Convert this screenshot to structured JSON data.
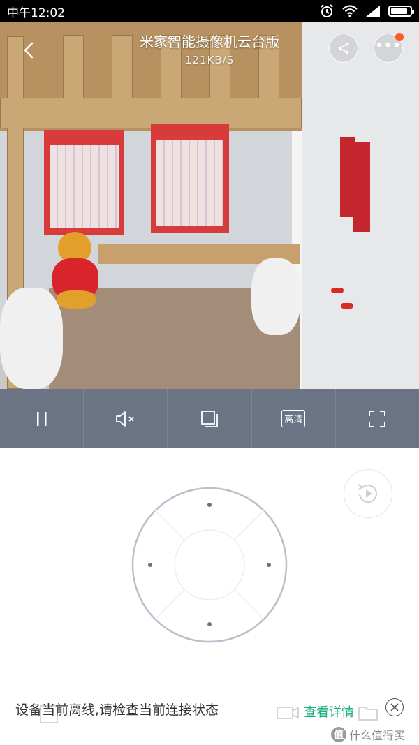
{
  "status_bar": {
    "time": "中午12:02",
    "icons": [
      "alarm-icon",
      "wifi-icon",
      "signal-icon",
      "battery-icon"
    ],
    "battery_level": 0.9
  },
  "header": {
    "title": "米家智能摄像机云台版",
    "bitrate": "121KB/S",
    "icons": [
      "back-icon",
      "share-icon",
      "more-icon"
    ],
    "notification_dot_color": "#ff5a1f"
  },
  "controls": {
    "hd_label": "高清",
    "icons": [
      "pause-icon",
      "mute-icon",
      "window-icon",
      "fullscreen-icon"
    ],
    "bar_color": "#6b7485"
  },
  "ptz": {
    "icons": [
      "history-playback-icon",
      "direction-pad"
    ]
  },
  "notice": {
    "message": "设备当前离线,请检查当前连接状态",
    "link_label": "查看详情",
    "link_color": "#1cb084",
    "icons": [
      "close-icon"
    ]
  },
  "watermark": {
    "logo": "值",
    "text": "什么值得买"
  }
}
